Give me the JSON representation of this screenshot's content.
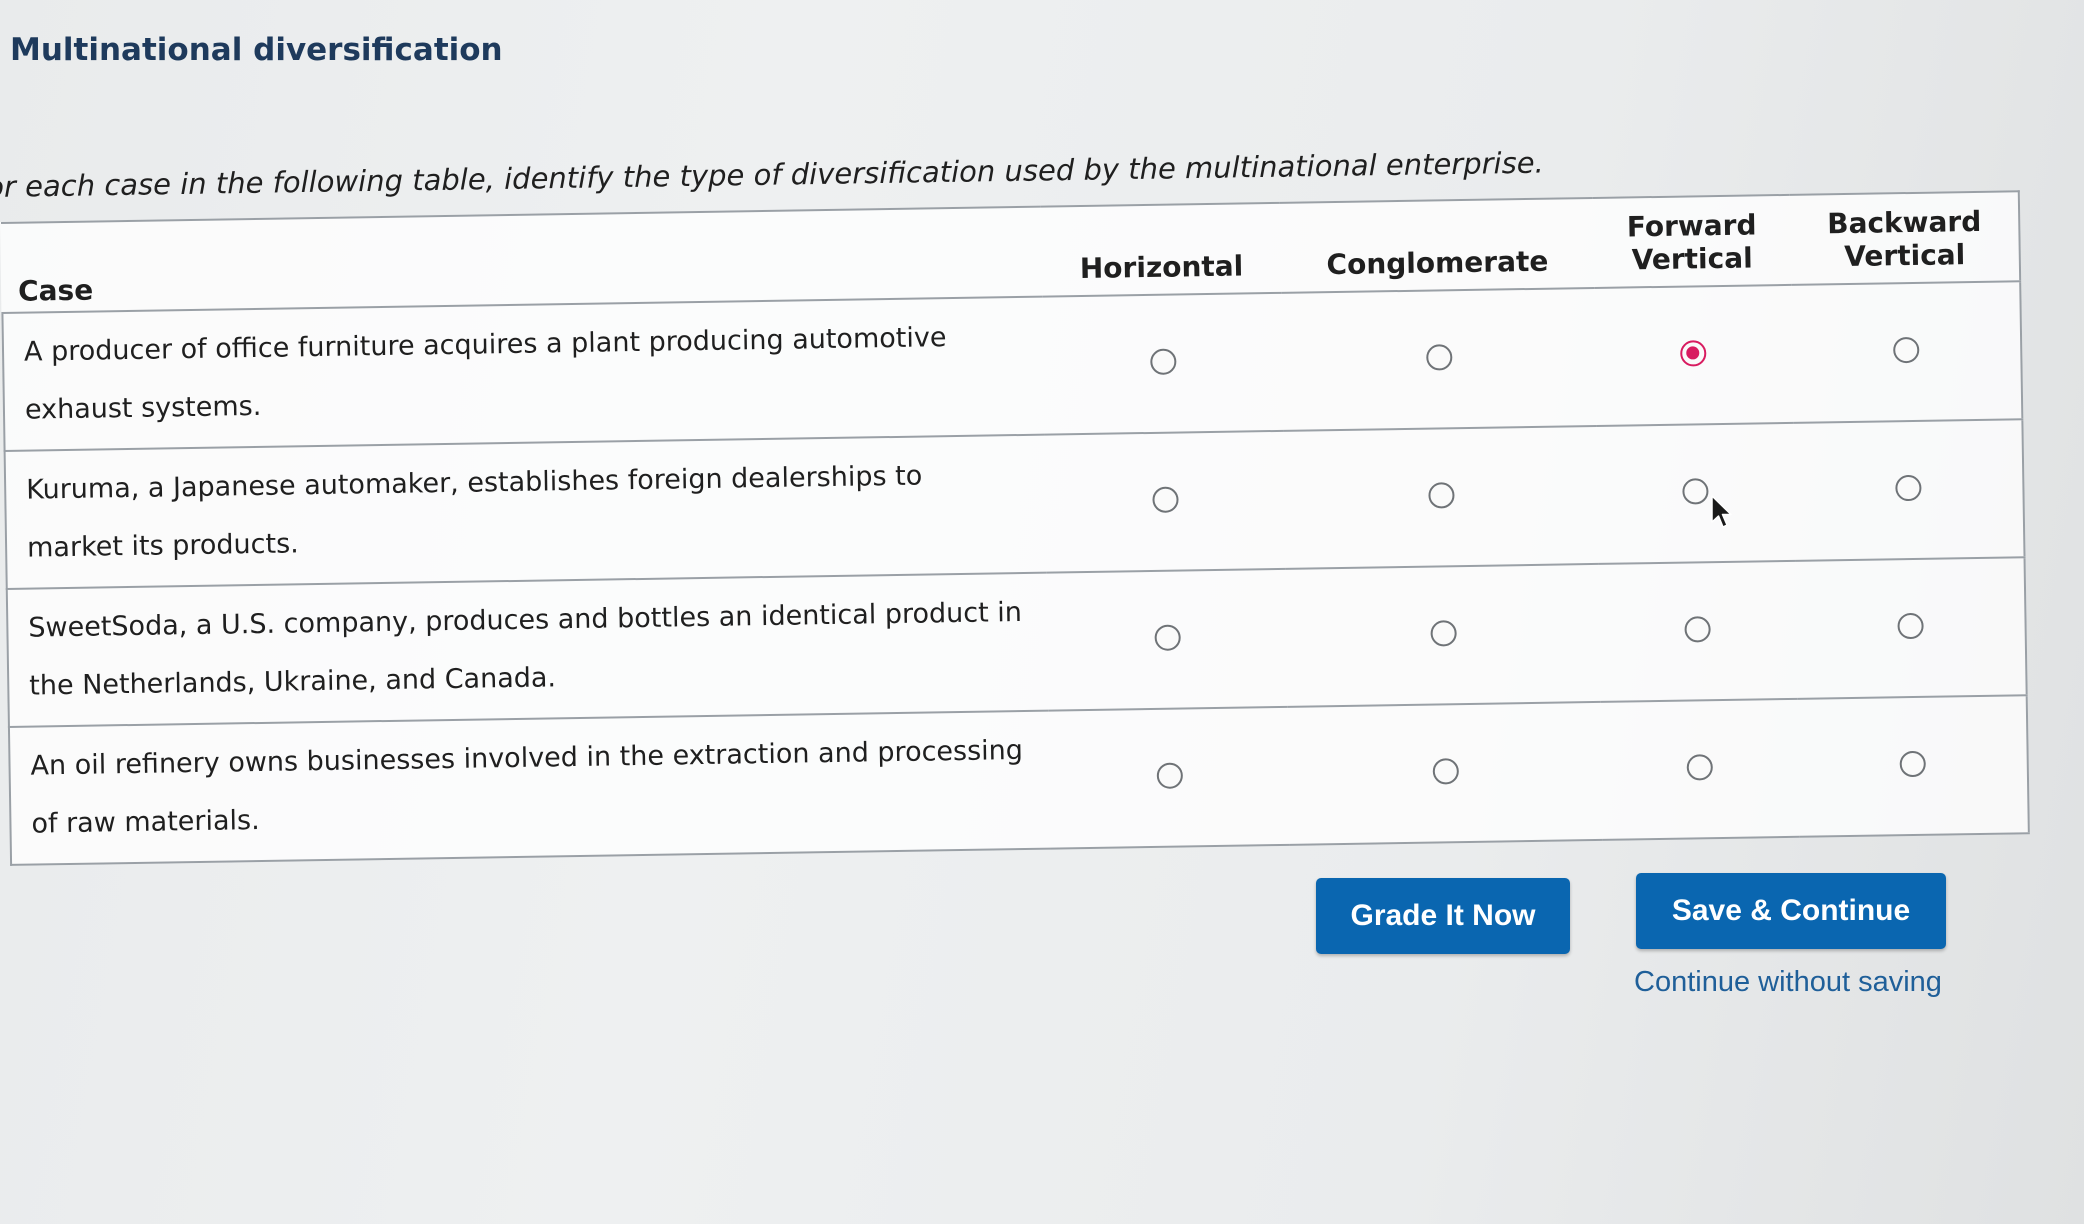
{
  "page": {
    "title": "Multinational diversification",
    "instructions": "or each case in the following table, identify the type of diversification used by the multinational enterprise."
  },
  "table": {
    "headers": {
      "case": "Case",
      "horizontal": "Horizontal",
      "conglomerate": "Conglomerate",
      "forward_vertical_line1": "Forward",
      "forward_vertical_line2": "Vertical",
      "backward_vertical_line1": "Backward",
      "backward_vertical_line2": "Vertical"
    },
    "rows": [
      {
        "case": "A producer of office furniture acquires a plant producing automotive exhaust systems.",
        "selected": "Forward Vertical"
      },
      {
        "case": "Kuruma, a Japanese automaker, establishes foreign dealerships to market its products.",
        "selected": ""
      },
      {
        "case": "SweetSoda, a U.S. company, produces and bottles an identical product in the Netherlands, Ukraine, and Canada.",
        "selected": ""
      },
      {
        "case": "An oil refinery owns businesses involved in the extraction and processing of raw materials.",
        "selected": ""
      }
    ]
  },
  "actions": {
    "grade_label": "Grade It Now",
    "save_label": "Save & Continue",
    "continue_label": "Continue without saving"
  },
  "colors": {
    "title": "#1e3a5c",
    "button": "#0a66b0",
    "link": "#1f5f99",
    "selected_radio": "#d81b60"
  },
  "icons": {
    "cursor": "mouse-pointer-icon"
  }
}
